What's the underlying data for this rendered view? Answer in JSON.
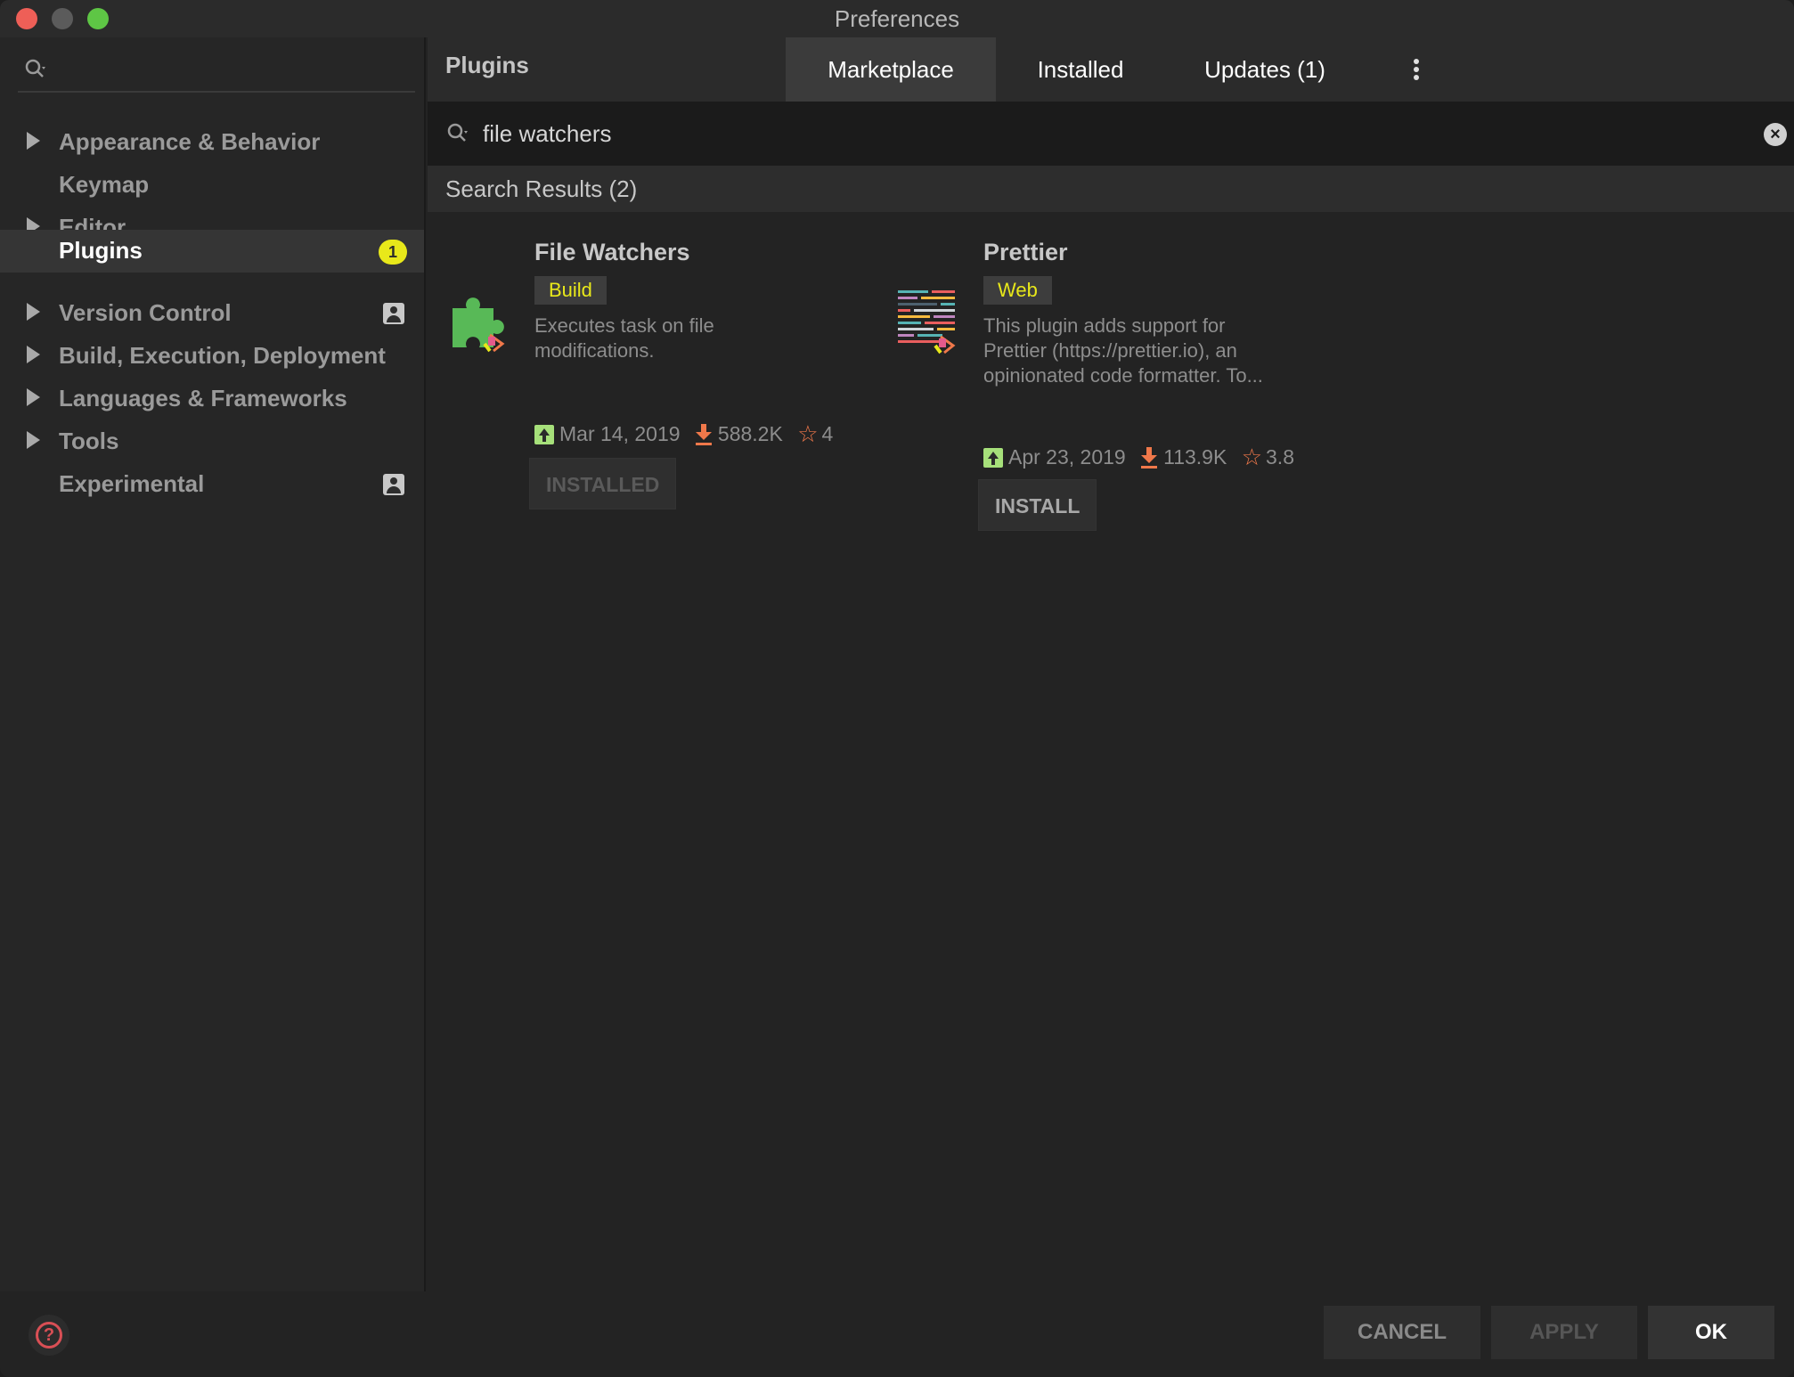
{
  "window": {
    "title": "Preferences"
  },
  "sidebar": {
    "search_placeholder": "",
    "items": [
      {
        "label": "Appearance & Behavior",
        "expandable": true
      },
      {
        "label": "Keymap",
        "expandable": false
      },
      {
        "label": "Editor",
        "expandable": true
      },
      {
        "label": "Plugins",
        "expandable": false,
        "selected": true,
        "badge": "1"
      },
      {
        "label": "Version Control",
        "expandable": true,
        "icon": "user-profile-icon"
      },
      {
        "label": "Build, Execution, Deployment",
        "expandable": true
      },
      {
        "label": "Languages & Frameworks",
        "expandable": true
      },
      {
        "label": "Tools",
        "expandable": true
      },
      {
        "label": "Experimental",
        "expandable": false,
        "icon": "user-profile-icon"
      }
    ]
  },
  "main": {
    "title": "Plugins",
    "tabs": [
      {
        "label": "Marketplace",
        "active": true
      },
      {
        "label": "Installed",
        "active": false
      },
      {
        "label": "Updates (1)",
        "active": false
      }
    ],
    "search": {
      "value": "file watchers",
      "placeholder": ""
    },
    "results_label": "Search Results (2)",
    "plugins": [
      {
        "name": "File Watchers",
        "tag": "Build",
        "description_lines": [
          "Executes task on file",
          "modifications."
        ],
        "date": "Mar 14, 2019",
        "downloads": "588.2K",
        "rating": "4",
        "button": "INSTALLED",
        "icon": "puzzle-piece-icon"
      },
      {
        "name": "Prettier",
        "tag": "Web",
        "description_lines": [
          "This plugin adds support for",
          "Prettier (https://prettier.io), an",
          "opinionated code formatter. To..."
        ],
        "date": "Apr 23, 2019",
        "downloads": "113.9K",
        "rating": "3.8",
        "button": "INSTALL",
        "icon": "prettier-logo-icon"
      }
    ]
  },
  "footer": {
    "cancel": "CANCEL",
    "apply": "APPLY",
    "ok": "OK",
    "help": "?"
  },
  "colors": {
    "tag_text": "#e8e81a",
    "badge": "#e8e81a",
    "accent_orange": "#f0784a",
    "update_green": "#a6e07a"
  }
}
